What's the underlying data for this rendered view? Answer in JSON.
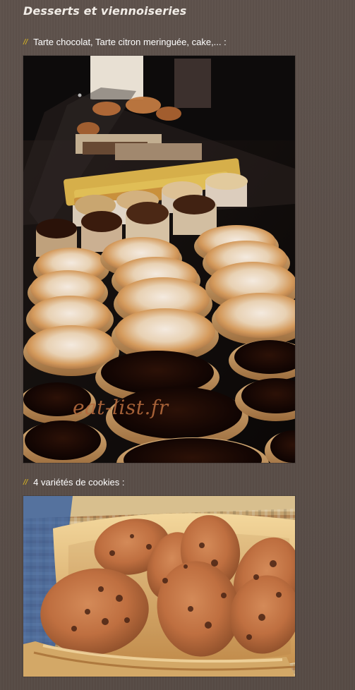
{
  "section": {
    "title": "Desserts et viennoiseries",
    "bullet_mark": "//"
  },
  "items": [
    {
      "caption": "Tarte chocolat, Tarte citron meringuée, cake,... :",
      "watermark": "eat-list.fr"
    },
    {
      "caption": "4 variétés de cookies :"
    }
  ]
}
